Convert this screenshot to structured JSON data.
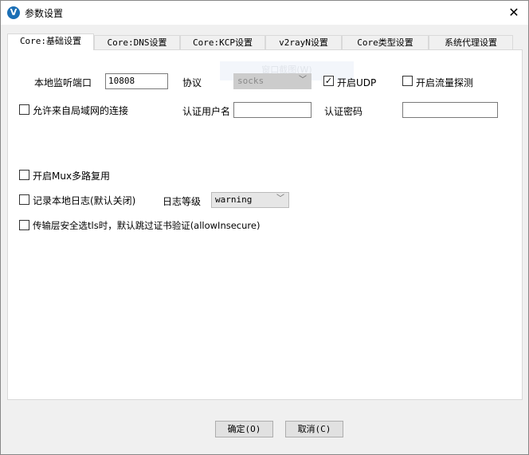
{
  "window": {
    "title": "参数设置",
    "logo": "V",
    "close_icon": "✕"
  },
  "tabs": [
    {
      "label": "Core:基础设置"
    },
    {
      "label": "Core:DNS设置"
    },
    {
      "label": "Core:KCP设置"
    },
    {
      "label": "v2rayN设置"
    },
    {
      "label": "Core类型设置"
    },
    {
      "label": "系统代理设置"
    }
  ],
  "ghost_tooltip": "窗口截图(W)",
  "form": {
    "local_port_label": "本地监听端口",
    "local_port_value": "10808",
    "protocol_label": "协议",
    "protocol_value": "socks",
    "udp_label": "开启UDP",
    "udp_checked": true,
    "sniff_label": "开启流量探测",
    "sniff_checked": false,
    "lan_label": "允许来自局域网的连接",
    "lan_checked": false,
    "user_label": "认证用户名",
    "user_value": "",
    "pass_label": "认证密码",
    "pass_value": "",
    "mux_label": "开启Mux多路复用",
    "mux_checked": false,
    "log_label": "记录本地日志(默认关闭)",
    "log_checked": false,
    "loglevel_label": "日志等级",
    "loglevel_value": "warning",
    "insecure_label": "传输层安全选tls时，默认跳过证书验证(allowInsecure)",
    "insecure_checked": false
  },
  "buttons": {
    "ok": "确定(O)",
    "cancel": "取消(C)"
  }
}
